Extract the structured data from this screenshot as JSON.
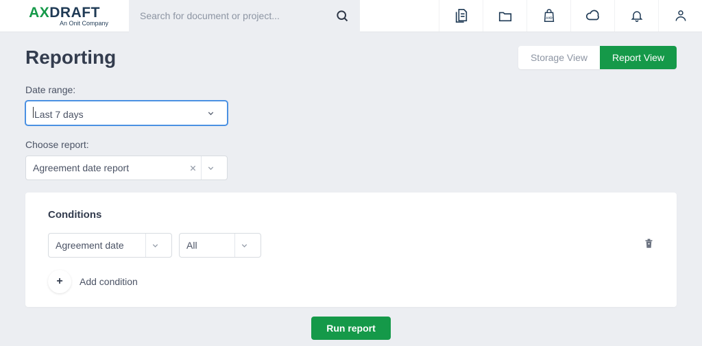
{
  "brand": {
    "ax": "AX",
    "draft": "DRAFT",
    "sub": "An Onit Company"
  },
  "search": {
    "placeholder": "Search for document or project..."
  },
  "page": {
    "title": "Reporting",
    "views": {
      "storage": "Storage View",
      "report": "Report View"
    }
  },
  "date_range": {
    "label": "Date range:",
    "value": "Last 7 days"
  },
  "choose_report": {
    "label": "Choose report:",
    "value": "Agreement date report"
  },
  "conditions": {
    "title": "Conditions",
    "row": {
      "field": "Agreement date",
      "operator": "All"
    },
    "add_label": "Add condition"
  },
  "run_label": "Run report"
}
